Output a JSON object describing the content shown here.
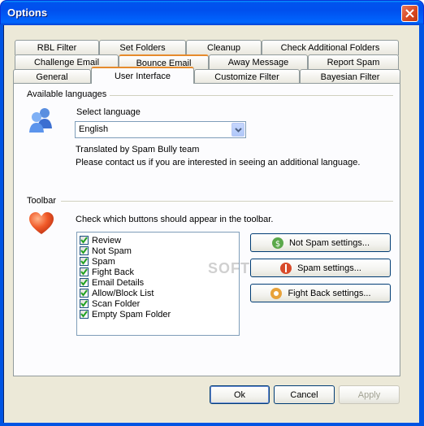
{
  "window": {
    "title": "Options"
  },
  "tabs": {
    "row1": [
      "RBL Filter",
      "Set Folders",
      "Cleanup",
      "Check Additional Folders"
    ],
    "row2": [
      "Challenge Email",
      "Bounce Email",
      "Away Message",
      "Report Spam"
    ],
    "row3": [
      "General",
      "User Interface",
      "Customize Filter",
      "Bayesian Filter"
    ],
    "active": "User Interface"
  },
  "languages": {
    "group_label": "Available languages",
    "select_label": "Select language",
    "selected": "English",
    "translated_by": "Translated by Spam Bully team",
    "contact_note": "Please contact us if you are interested in seeing an additional language."
  },
  "toolbar": {
    "group_label": "Toolbar",
    "instruction": "Check which buttons should appear in the toolbar.",
    "items": [
      {
        "label": "Review",
        "checked": true
      },
      {
        "label": "Not Spam",
        "checked": true
      },
      {
        "label": "Spam",
        "checked": true
      },
      {
        "label": "Fight Back",
        "checked": true
      },
      {
        "label": "Email Details",
        "checked": true
      },
      {
        "label": "Allow/Block List",
        "checked": true
      },
      {
        "label": "Scan Folder",
        "checked": true
      },
      {
        "label": "Empty Spam Folder",
        "checked": true
      }
    ],
    "buttons": {
      "not_spam": "Not Spam settings...",
      "spam": "Spam settings...",
      "fight_back": "Fight Back settings..."
    }
  },
  "watermark": "SOFTPEDIA",
  "footer": {
    "ok": "Ok",
    "cancel": "Cancel",
    "apply": "Apply"
  },
  "colors": {
    "title_bar": "#0053ee",
    "tab_hot": "#e68b2c",
    "face": "#ece9d8"
  }
}
